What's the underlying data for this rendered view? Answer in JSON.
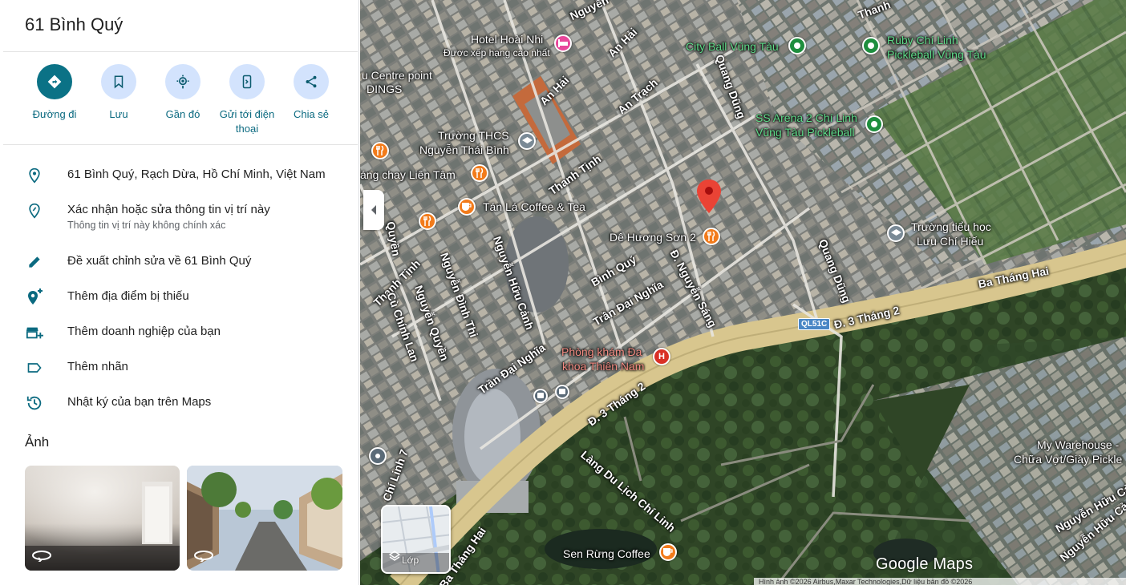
{
  "place": {
    "title": "61 Bình Quý"
  },
  "actions": [
    {
      "label": "Đường đi",
      "icon": "directions-icon"
    },
    {
      "label": "Lưu",
      "icon": "bookmark-icon"
    },
    {
      "label": "Gần đó",
      "icon": "nearby-icon"
    },
    {
      "label": "Gửi tới điện thoại",
      "icon": "send-to-phone-icon"
    },
    {
      "label": "Chia sẻ",
      "icon": "share-icon"
    }
  ],
  "info": [
    {
      "text": "61 Bình Quý, Rạch Dừa, Hồ Chí Minh, Việt Nam",
      "icon": "location-pin-icon"
    },
    {
      "text": "Xác nhận hoặc sửa thông tin vị trí này",
      "sub": "Thông tin vị trí này không chính xác",
      "icon": "edit-location-icon"
    },
    {
      "text": "Đề xuất chỉnh sửa về 61 Bình Quý",
      "icon": "pencil-icon"
    },
    {
      "text": "Thêm địa điểm bị thiếu",
      "icon": "add-place-icon"
    },
    {
      "text": "Thêm doanh nghiệp của bạn",
      "icon": "add-business-icon"
    },
    {
      "text": "Thêm nhãn",
      "icon": "label-icon"
    },
    {
      "text": "Nhật ký của bạn trên Maps",
      "icon": "history-icon"
    }
  ],
  "photos": {
    "title": "Ảnh"
  },
  "map": {
    "roads": {
      "ba_thang_hai_1": "Ba Tháng Hai",
      "ba_thang_hai_2": "Ba Tháng Hai",
      "d3thang2_a": "Đ. 3 Tháng 2",
      "d3thang2_b": "Đ. 3 Tháng 2",
      "ql51c": "QL51C",
      "quang_dung_1": "Quang Dũng",
      "quang_dung_2": "Quang Dũng",
      "an_hai_1": "An Hải",
      "an_hai_2": "An Hải",
      "an_trach": "An Trạch",
      "thanh_tinh_1": "Thanh Tịnh",
      "thanh_tinh_2": "Thanh Tịnh",
      "binh_quy": "Bình Quý",
      "nguyen_sang": "Đ. Nguyễn Sáng",
      "tran_dai_nghia_1": "Trần Đại Nghĩa",
      "tran_dai_nghia_2": "Trần Đại Nghĩa",
      "nguyen_huu_canh_1": "Nguyễn Hữu Cảnh",
      "nguyen_huu_canh_2": "Nguyễn Hữu Cảnh",
      "nguyen_huu_canh_3": "Nguyễn Hữu Cảnh",
      "nguyen_dinh_thi": "Nguyễn Đình Thi",
      "nguyen_quyen": "Nguyễn Quyền",
      "cu_chinh_lan": "Cù Chính Lan",
      "chi_linh_7": "Chí Linh 7",
      "lang_du_lich": "Làng Du Lịch Chí Linh",
      "nguyen_top": "Nguyễn",
      "quyen_left": "Quyền",
      "thanh_top": "Thanh"
    },
    "pois": {
      "hotel_name": "Hotel Hoài Nhi",
      "hotel_sub": "Được xếp hạng cao nhất",
      "centre_point": "u Centre point",
      "dings": "DINGS",
      "truong_thcs_1": "Trường THCS",
      "truong_thcs_2": "Nguyễn Thái Bình",
      "chay_lien_tam": "áng chay Liên Tâm",
      "tan_la": "Tán Lá Coffee & Tea",
      "de_huong": "Dê Hương Sơn 2",
      "city_ball": "City Ball Vũng Tàu",
      "ruby_1": "Ruby Chí Linh",
      "ruby_2": "Pickleball Vũng Tàu",
      "ss_arena_1": "SS Arena 2 Chí Linh",
      "ss_arena_2": "Vũng Tàu Pickleball",
      "truong_tieu_hoc_1": "Trường tiểu học",
      "truong_tieu_hoc_2": "Lưu Chí Hiếu",
      "phong_kham_1": "Phòng khám Đa",
      "phong_kham_2": "khoa Thiên Nam",
      "my_warehouse_1": "My Warehouse -",
      "my_warehouse_2": "Chữa Vợt/Giày Pickle",
      "sen_rung": "Sen Rừng Coffee"
    },
    "layer_label": "Lớp",
    "logo": "Google Maps",
    "attribution": "Hình ảnh ©2026 Airbus,Maxar Technologies,Dữ liệu bản đồ ©2026"
  },
  "colors": {
    "accent": "#0b7286",
    "action_circle": "#d3e3fd",
    "poi_green": "#3fbf6a",
    "poi_orange": "#f27b1b",
    "poi_pink": "#e8479b",
    "poi_red_text": "#f28b82",
    "pin_red": "#ea4335"
  }
}
